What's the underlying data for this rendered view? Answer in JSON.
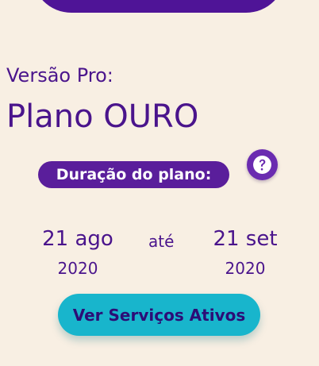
{
  "plan": {
    "version_label": "Versão Pro:",
    "name": "Plano OURO",
    "duration_label": "Duração do plano:"
  },
  "help": {
    "icon": "question-mark-icon"
  },
  "dates": {
    "start_day_month": "21 ago",
    "start_year": "2020",
    "separator": "até",
    "end_day_month": "21 set",
    "end_year": "2020"
  },
  "actions": {
    "view_services_label": "Ver Serviços Ativos"
  },
  "colors": {
    "background": "#f8efe3",
    "primary": "#4a148c",
    "accent": "#18b5cc"
  }
}
